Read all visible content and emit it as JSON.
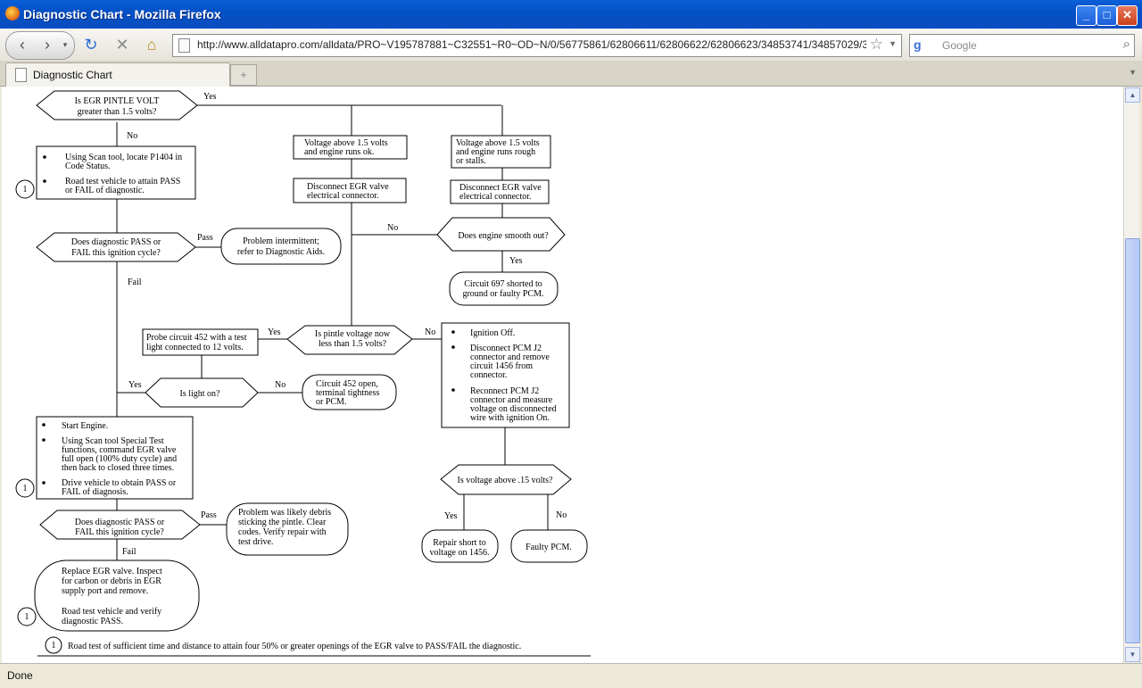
{
  "window": {
    "title": "Diagnostic Chart - Mozilla Firefox",
    "minimize": "_",
    "maximize": "□",
    "close": "✕"
  },
  "navbar": {
    "url": "http://www.alldatapro.com/alldata/PRO~V195787881~C32551~R0~OD~N/0/56775861/62806611/62806622/62806623/34853741/34857029/34857030/3",
    "search_placeholder": "Google"
  },
  "tabs": [
    {
      "label": "Diagnostic Chart"
    }
  ],
  "status": {
    "text": "Done"
  },
  "chart": {
    "q_pintle": [
      "Is EGR PINTLE VOLT",
      "greater than 1.5 volts?"
    ],
    "yes": "Yes",
    "no": "No",
    "pass": "Pass",
    "fail": "Fail",
    "box_scan1": [
      "Using Scan tool, locate P1404 in",
      "Code Status."
    ],
    "box_scan2": [
      "Road test vehicle to attain PASS",
      "or FAIL of diagnostic."
    ],
    "q_pass1": [
      "Does diagnostic PASS or",
      "FAIL this ignition cycle?"
    ],
    "r_intermittent": [
      "Problem intermittent;",
      "refer to Diagnostic Aids."
    ],
    "box_v_ok": [
      "Voltage above 1.5 volts",
      "and engine runs ok."
    ],
    "box_v_rough": [
      "Voltage above 1.5 volts",
      "and engine runs rough",
      "or stalls."
    ],
    "box_disc1": [
      "Disconnect EGR valve",
      "electrical connector."
    ],
    "box_disc2": [
      "Disconnect EGR valve",
      "electrical connector."
    ],
    "q_smooth": "Does engine smooth out?",
    "r_circuit697": [
      "Circuit 697 shorted to",
      "ground or faulty PCM."
    ],
    "box_probe": [
      "Probe circuit 452 with a test",
      "light connected to 12 volts."
    ],
    "q_pintle_less": [
      "Is pintle voltage now",
      "less than 1.5 volts?"
    ],
    "box_ign": {
      "b1": [
        "Ignition Off."
      ],
      "b2": [
        "Disconnect PCM J2",
        "connector and remove",
        "circuit 1456 from",
        "connector."
      ],
      "b3": [
        "Reconnect PCM J2",
        "connector and measure",
        "voltage on disconnected",
        "wire with ignition On."
      ]
    },
    "q_light": "Is light on?",
    "r_circuit452": [
      "Circuit 452 open,",
      "terminal tightness",
      "or PCM."
    ],
    "box_start": {
      "b1": [
        "Start Engine."
      ],
      "b2": [
        "Using Scan tool Special Test",
        "functions, command EGR valve",
        "full open (100% duty cycle) and",
        "then back to closed three times."
      ],
      "b3": [
        "Drive vehicle to obtain PASS or",
        "FAIL of diagnosis."
      ]
    },
    "q_voltage15": "Is voltage above .15 volts?",
    "q_pass2": [
      "Does diagnostic PASS or",
      "FAIL this ignition cycle?"
    ],
    "r_debris": [
      "Problem was likely debris",
      "sticking the pintle. Clear",
      "codes. Verify repair with",
      "test drive."
    ],
    "r_repair": [
      "Repair short to",
      "voltage on 1456."
    ],
    "r_faulty": "Faulty PCM.",
    "r_replace": [
      "Replace EGR valve. Inspect",
      "for carbon or debris in EGR",
      "supply port and remove.",
      "",
      "Road test vehicle and verify",
      "diagnostic PASS."
    ],
    "footnote_marker": "1",
    "footnote": "Road test of sufficient time and distance to attain four 50% or greater openings of the EGR valve to PASS/FAIL the diagnostic."
  }
}
